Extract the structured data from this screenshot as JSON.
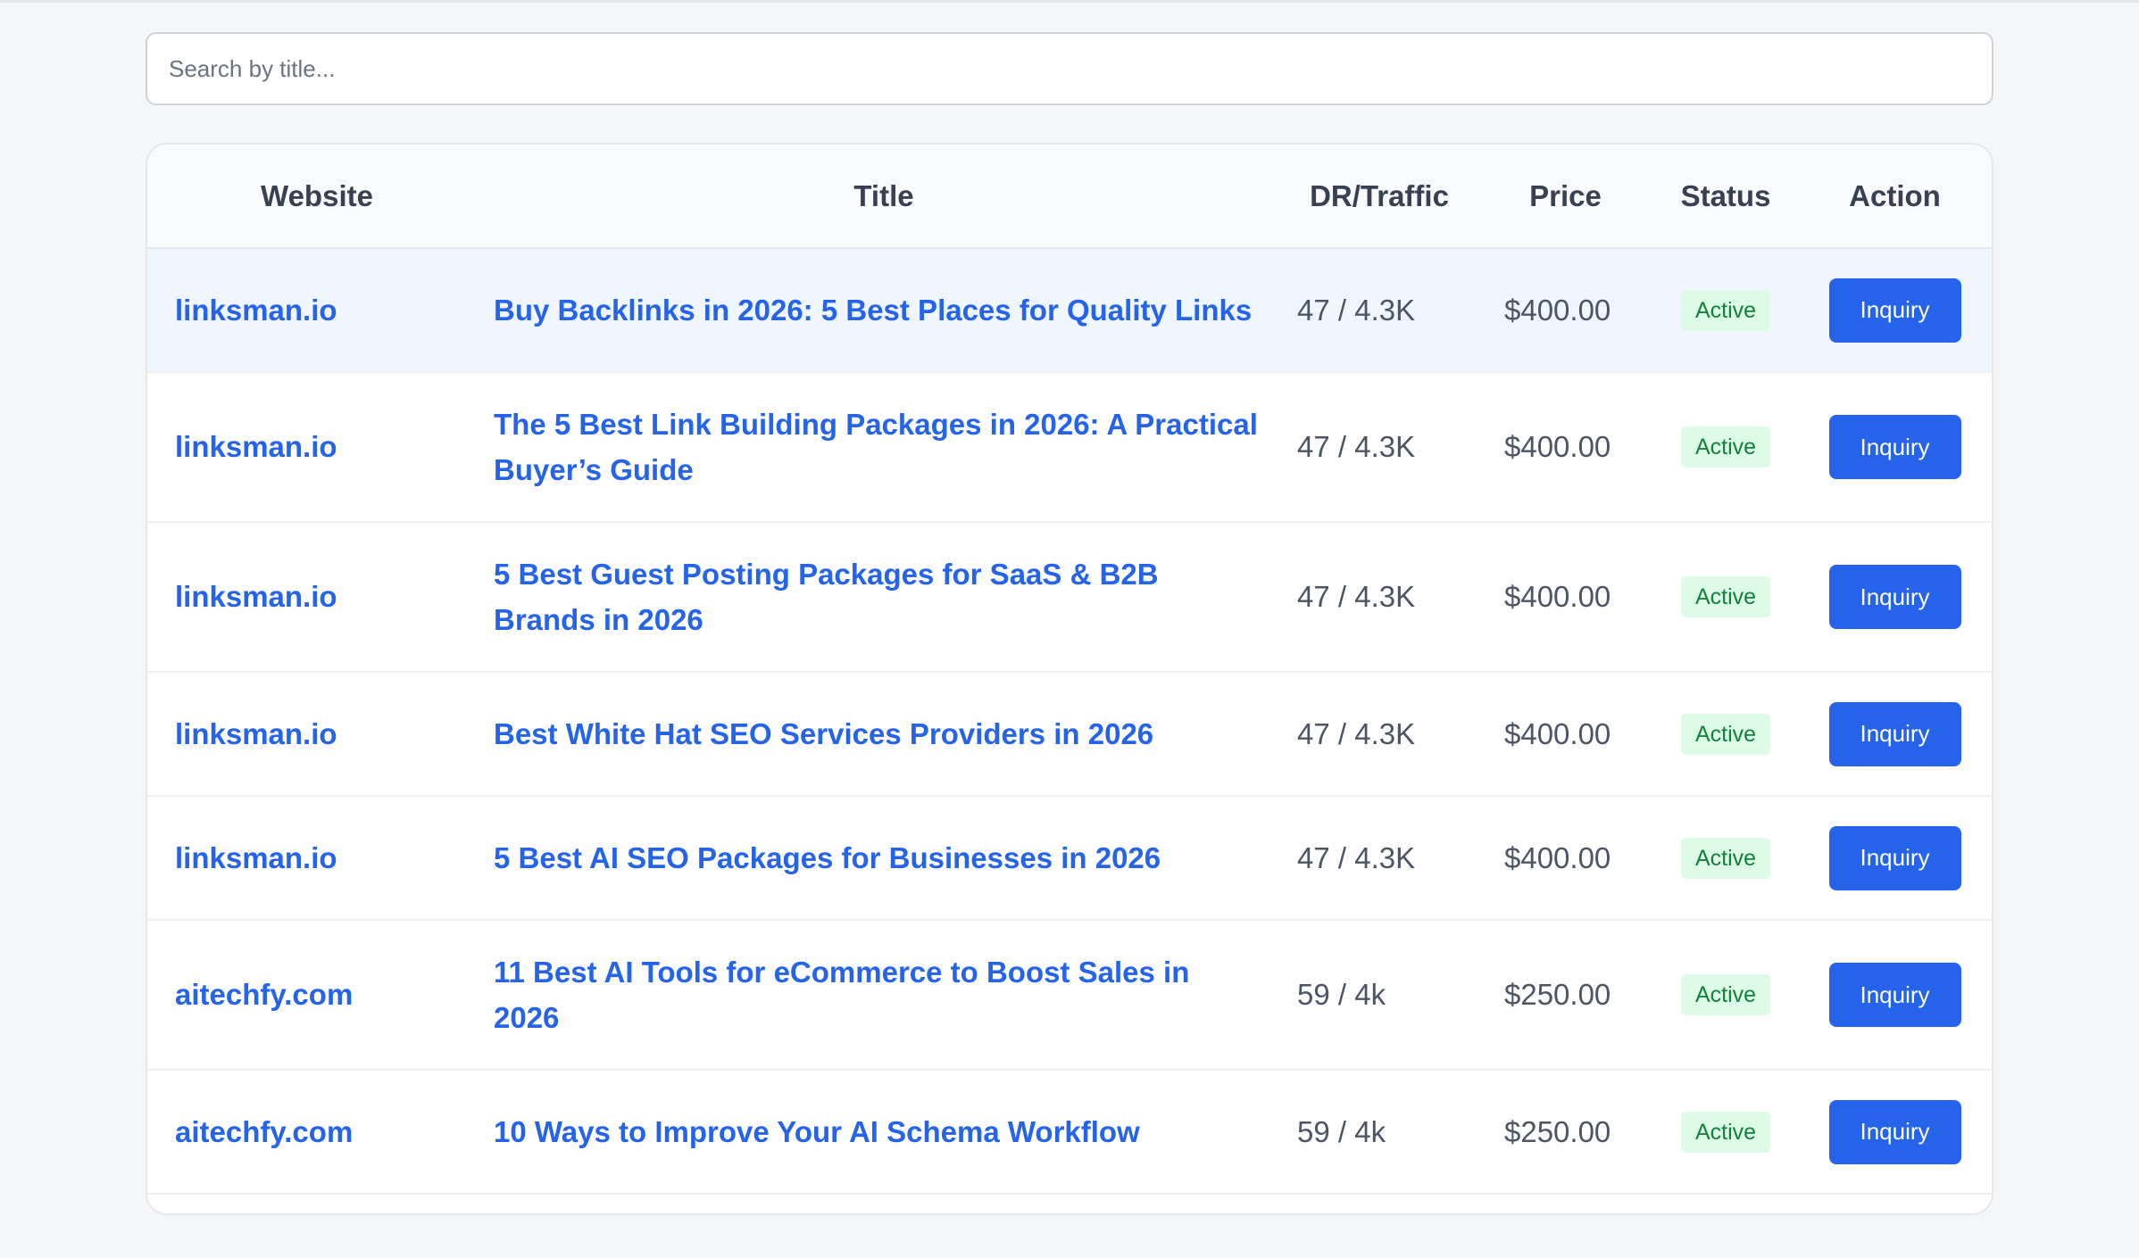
{
  "search": {
    "placeholder": "Search by title..."
  },
  "table": {
    "headers": {
      "website": "Website",
      "title": "Title",
      "dr_traffic": "DR/Traffic",
      "price": "Price",
      "status": "Status",
      "action": "Action"
    },
    "rows": [
      {
        "website": "linksman.io",
        "title": "Buy Backlinks in 2026: 5 Best Places for Quality Links",
        "dr_traffic": "47 / 4.3K",
        "price": "$400.00",
        "status": "Active",
        "action": "Inquiry"
      },
      {
        "website": "linksman.io",
        "title": "The 5 Best Link Building Packages in 2026: A Practical Buyer’s Guide",
        "dr_traffic": "47 / 4.3K",
        "price": "$400.00",
        "status": "Active",
        "action": "Inquiry"
      },
      {
        "website": "linksman.io",
        "title": "5 Best Guest Posting Packages for SaaS & B2B Brands in 2026",
        "dr_traffic": "47 / 4.3K",
        "price": "$400.00",
        "status": "Active",
        "action": "Inquiry"
      },
      {
        "website": "linksman.io",
        "title": "Best White Hat SEO Services Providers in 2026",
        "dr_traffic": "47 / 4.3K",
        "price": "$400.00",
        "status": "Active",
        "action": "Inquiry"
      },
      {
        "website": "linksman.io",
        "title": "5 Best AI SEO Packages for Businesses in 2026",
        "dr_traffic": "47 / 4.3K",
        "price": "$400.00",
        "status": "Active",
        "action": "Inquiry"
      },
      {
        "website": "aitechfy.com",
        "title": "11 Best AI Tools for eCommerce to Boost Sales in 2026",
        "dr_traffic": "59 / 4k",
        "price": "$250.00",
        "status": "Active",
        "action": "Inquiry"
      },
      {
        "website": "aitechfy.com",
        "title": "10 Ways to Improve Your AI Schema Workflow",
        "dr_traffic": "59 / 4k",
        "price": "$250.00",
        "status": "Active",
        "action": "Inquiry"
      }
    ]
  },
  "colors": {
    "link": "#2563eb",
    "button_bg": "#2563eb",
    "badge_bg": "#dcfce7",
    "badge_text": "#15803d",
    "row_highlight": "#eff6ff",
    "page_bg": "#f5f6f8"
  }
}
